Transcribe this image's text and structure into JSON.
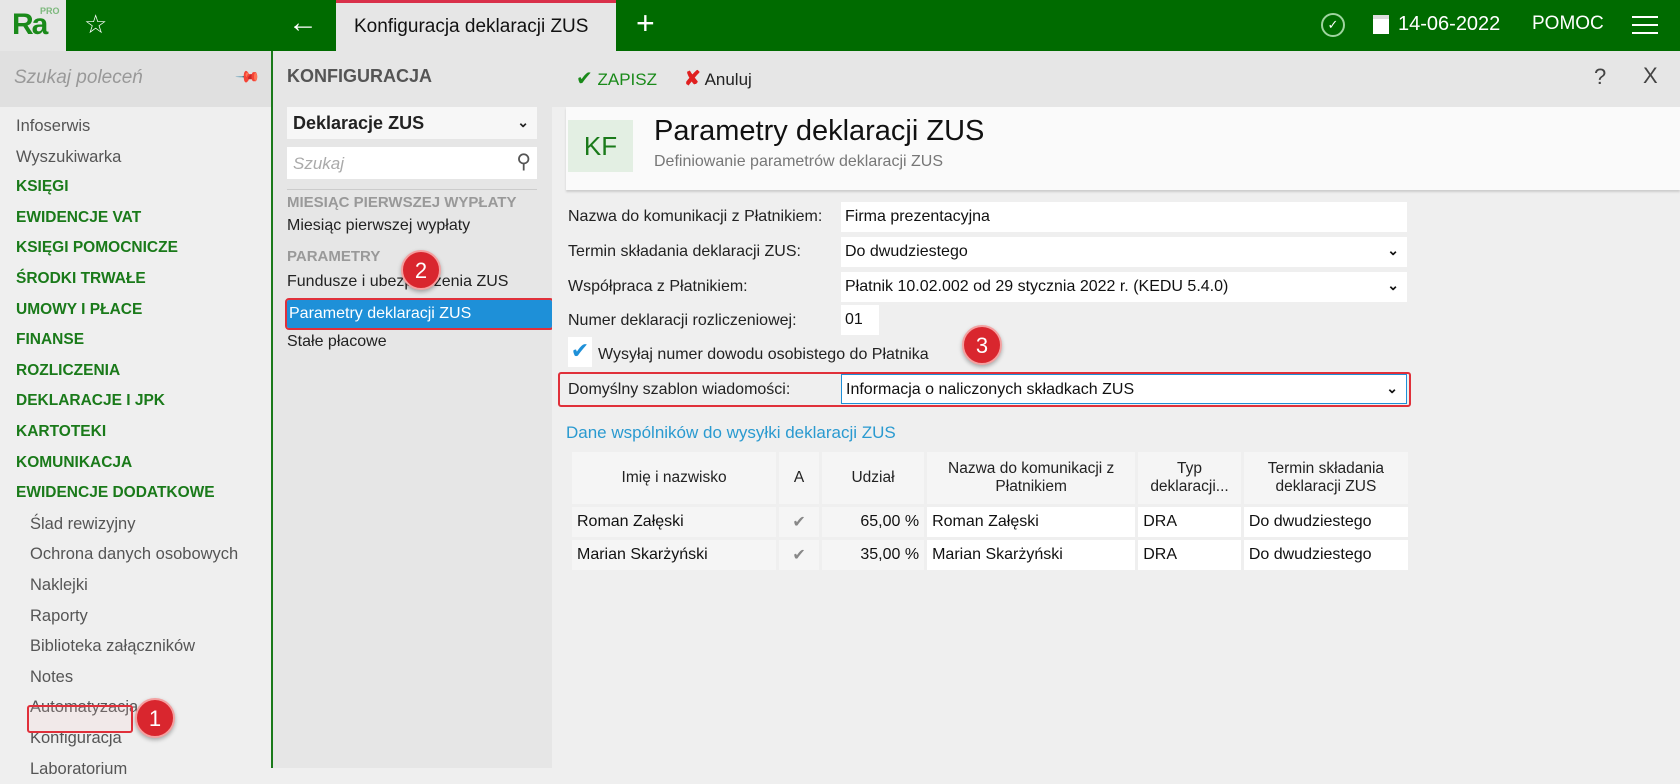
{
  "topbar": {
    "logo": "Ra",
    "logo_sup": "PRO",
    "tab_title": "Konfiguracja deklaracji ZUS",
    "date": "14-06-2022",
    "help": "POMOC"
  },
  "sidebar": {
    "search_placeholder": "Szukaj poleceń",
    "items": [
      {
        "label": "Infoserwis",
        "type": "item"
      },
      {
        "label": "Wyszukiwarka",
        "type": "item"
      },
      {
        "label": "KSIĘGI",
        "type": "grp"
      },
      {
        "label": "EWIDENCJE VAT",
        "type": "grp"
      },
      {
        "label": "KSIĘGI POMOCNICZE",
        "type": "grp"
      },
      {
        "label": "ŚRODKI TRWAŁE",
        "type": "grp"
      },
      {
        "label": "UMOWY I PŁACE",
        "type": "grp"
      },
      {
        "label": "FINANSE",
        "type": "grp"
      },
      {
        "label": "ROZLICZENIA",
        "type": "grp"
      },
      {
        "label": "DEKLARACJE I JPK",
        "type": "grp"
      },
      {
        "label": "KARTOTEKI",
        "type": "grp"
      },
      {
        "label": "KOMUNIKACJA",
        "type": "grp"
      },
      {
        "label": "EWIDENCJE DODATKOWE",
        "type": "grp"
      },
      {
        "label": "Ślad rewizyjny",
        "type": "sub"
      },
      {
        "label": "Ochrona danych osobowych",
        "type": "sub"
      },
      {
        "label": "Naklejki",
        "type": "sub"
      },
      {
        "label": "Raporty",
        "type": "sub"
      },
      {
        "label": "Biblioteka załączników",
        "type": "sub"
      },
      {
        "label": "Notes",
        "type": "sub"
      },
      {
        "label": "Automatyzacja",
        "type": "sub"
      },
      {
        "label": "Konfiguracja",
        "type": "sub"
      },
      {
        "label": "Laboratorium",
        "type": "sub"
      }
    ]
  },
  "panel": {
    "title": "KONFIGURACJA",
    "select": "Deklaracje ZUS",
    "search_placeholder": "Szukaj",
    "sec1": "MIESIĄC PIERWSZEJ WYPŁATY",
    "item1": "Miesiąc pierwszej wypłaty",
    "sec2": "PARAMETRY",
    "item2": "Fundusze i ubezpieczenia ZUS",
    "item3": "Parametry deklaracji ZUS",
    "item4": "Stałe płacowe"
  },
  "toolbar": {
    "save": "ZAPISZ",
    "cancel": "Anuluj",
    "help": "?",
    "close": "X"
  },
  "header": {
    "badge": "KF",
    "title": "Parametry deklaracji ZUS",
    "subtitle": "Definiowanie parametrów deklaracji ZUS"
  },
  "form": {
    "name_label": "Nazwa do komunikacji z Płatnikiem:",
    "name_value": "Firma prezentacyjna",
    "term_label": "Termin składania deklaracji ZUS:",
    "term_value": "Do dwudziestego",
    "coop_label": "Współpraca z Płatnikiem:",
    "coop_value": "Płatnik 10.02.002 od 29 stycznia 2022 r. (KEDU 5.4.0)",
    "num_label": "Numer deklaracji rozliczeniowej:",
    "num_value": "01",
    "send_id_label": "Wysyłaj numer dowodu osobistego do Płatnika",
    "send_id_checked": true,
    "template_label": "Domyślny szablon wiadomości:",
    "template_value": "Informacja o naliczonych składkach ZUS"
  },
  "partners": {
    "title": "Dane wspólników do wysyłki deklaracji ZUS",
    "headers": [
      "Imię i nazwisko",
      "A",
      "Udział",
      "Nazwa do komunikacji z Płatnikiem",
      "Typ deklaracji...",
      "Termin składania deklaracji ZUS"
    ],
    "rows": [
      [
        "Roman Załęski",
        "✔",
        "65,00 %",
        "Roman Załęski",
        "DRA",
        "Do dwudziestego"
      ],
      [
        "Marian Skarżyński",
        "✔",
        "35,00 %",
        "Marian Skarżyński",
        "DRA",
        "Do dwudziestego"
      ]
    ]
  },
  "annotations": [
    "1",
    "2",
    "3"
  ]
}
